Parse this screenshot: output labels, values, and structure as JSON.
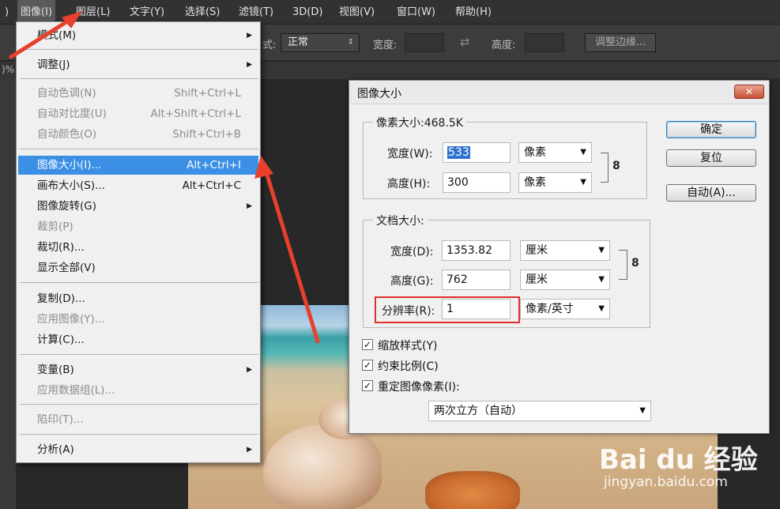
{
  "menubar": {
    "left_fragment": ")",
    "items": [
      "图像(I)",
      "图层(L)",
      "文字(Y)",
      "选择(S)",
      "滤镜(T)",
      "3D(D)",
      "视图(V)",
      "窗口(W)",
      "帮助(H)"
    ]
  },
  "optbar": {
    "style_label": "式:",
    "style_value": "正常",
    "width_label": "宽度:",
    "height_label": "高度:",
    "refine_button": "调整边缘..."
  },
  "tab_fragment": ")%",
  "image_menu": {
    "items": [
      {
        "label": "模式(M)",
        "shortcut": "",
        "submenu": true,
        "disabled": false
      },
      {
        "label": "调整(J)",
        "shortcut": "",
        "submenu": true,
        "disabled": false
      },
      {
        "label": "自动色调(N)",
        "shortcut": "Shift+Ctrl+L",
        "submenu": false,
        "disabled": true
      },
      {
        "label": "自动对比度(U)",
        "shortcut": "Alt+Shift+Ctrl+L",
        "submenu": false,
        "disabled": true
      },
      {
        "label": "自动颜色(O)",
        "shortcut": "Shift+Ctrl+B",
        "submenu": false,
        "disabled": true
      },
      {
        "label": "图像大小(I)...",
        "shortcut": "Alt+Ctrl+I",
        "submenu": false,
        "disabled": false,
        "highlighted": true
      },
      {
        "label": "画布大小(S)...",
        "shortcut": "Alt+Ctrl+C",
        "submenu": false,
        "disabled": false
      },
      {
        "label": "图像旋转(G)",
        "shortcut": "",
        "submenu": true,
        "disabled": false
      },
      {
        "label": "裁剪(P)",
        "shortcut": "",
        "submenu": false,
        "disabled": true
      },
      {
        "label": "裁切(R)...",
        "shortcut": "",
        "submenu": false,
        "disabled": false
      },
      {
        "label": "显示全部(V)",
        "shortcut": "",
        "submenu": false,
        "disabled": false
      },
      {
        "label": "复制(D)...",
        "shortcut": "",
        "submenu": false,
        "disabled": false
      },
      {
        "label": "应用图像(Y)...",
        "shortcut": "",
        "submenu": false,
        "disabled": true
      },
      {
        "label": "计算(C)...",
        "shortcut": "",
        "submenu": false,
        "disabled": false
      },
      {
        "label": "变量(B)",
        "shortcut": "",
        "submenu": true,
        "disabled": false
      },
      {
        "label": "应用数据组(L)...",
        "shortcut": "",
        "submenu": false,
        "disabled": true
      },
      {
        "label": "陷印(T)...",
        "shortcut": "",
        "submenu": false,
        "disabled": true
      },
      {
        "label": "分析(A)",
        "shortcut": "",
        "submenu": true,
        "disabled": false
      }
    ]
  },
  "dialog": {
    "title": "图像大小",
    "close": "✕",
    "pixel_legend": "像素大小:468.5K",
    "pixel_width_label": "宽度(W):",
    "pixel_width_value": "533",
    "pixel_width_unit": "像素",
    "pixel_height_label": "高度(H):",
    "pixel_height_value": "300",
    "pixel_height_unit": "像素",
    "doc_legend": "文档大小:",
    "doc_width_label": "宽度(D):",
    "doc_width_value": "1353.82",
    "doc_width_unit": "厘米",
    "doc_height_label": "高度(G):",
    "doc_height_value": "762",
    "doc_height_unit": "厘米",
    "resolution_label": "分辨率(R):",
    "resolution_value": "1",
    "resolution_unit": "像素/英寸",
    "ok": "确定",
    "reset": "复位",
    "auto": "自动(A)...",
    "scale_styles": "缩放样式(Y)",
    "constrain": "约束比例(C)",
    "resample": "重定图像像素(I):",
    "resample_method": "两次立方（自动）",
    "check_mark": "✓"
  },
  "watermark": {
    "brand": "Bai du 经验",
    "url": "jingyan.baidu.com"
  }
}
